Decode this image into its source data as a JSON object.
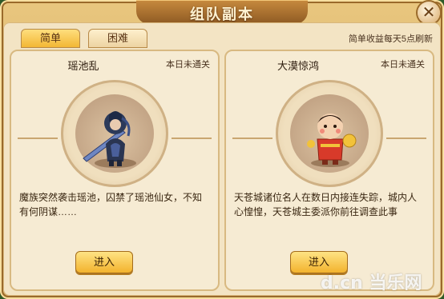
{
  "window": {
    "title": "组队副本",
    "close_glyph": "✕"
  },
  "tabs": [
    {
      "label": "简单",
      "active": true
    },
    {
      "label": "困难",
      "active": false
    }
  ],
  "refresh_note": "简单收益每天5点刷新",
  "dungeons": [
    {
      "name": "瑶池乱",
      "status": "本日未通关",
      "description": "魔族突然袭击瑶池，囚禁了瑶池仙女，不知有何阴谋……",
      "enter_label": "进入",
      "portrait_icon": "armored-warrior-icon"
    },
    {
      "name": "大漠惊鸿",
      "status": "本日未通关",
      "description": "天苍城诸位名人在数日内接连失踪，城内人心惶惶，天苍城主委派你前往调查此事",
      "enter_label": "进入",
      "portrait_icon": "festive-child-icon"
    }
  ],
  "watermark": "d.cn 当乐网",
  "colors": {
    "accent": "#f2b531",
    "panel": "#f3e4c4",
    "frame": "#9a6a2b"
  }
}
